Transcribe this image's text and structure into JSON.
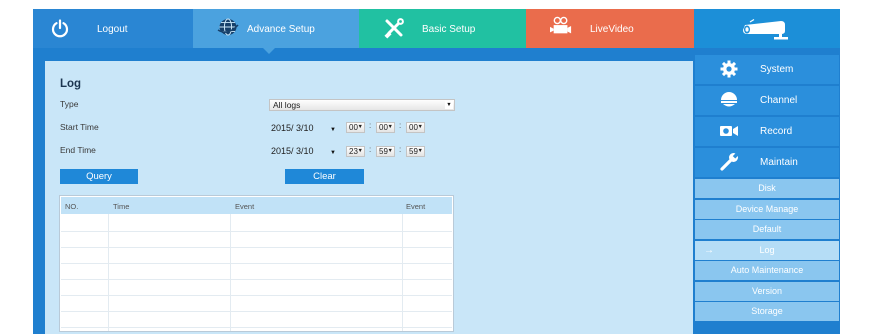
{
  "nav": {
    "tabs": [
      {
        "label": "Logout",
        "icon": "power-icon",
        "color": "#2a86d3"
      },
      {
        "label": "Advance Setup",
        "icon": "globe-icon",
        "color": "#4ba2df"
      },
      {
        "label": "Basic Setup",
        "icon": "tools-icon",
        "color": "#21c1a2"
      },
      {
        "label": "LiveVideo",
        "icon": "video-camera-icon",
        "color": "#ea6c4c"
      }
    ],
    "camera_icon": "bullet-camera-icon"
  },
  "log": {
    "title": "Log",
    "type_label": "Type",
    "type_value": "All logs",
    "start_label": "Start Time",
    "start_date": "2015/ 3/10",
    "start_hour": "00",
    "start_min": "00",
    "start_sec": "00",
    "end_label": "End Time",
    "end_date": "2015/ 3/10",
    "end_hour": "23",
    "end_min": "59",
    "end_sec": "59",
    "query_label": "Query",
    "clear_label": "Clear",
    "columns": [
      "NO.",
      "Time",
      "Event",
      "Event"
    ],
    "rows": []
  },
  "menu": {
    "main_items": [
      {
        "label": "System",
        "icon": "gear-icon"
      },
      {
        "label": "Channel",
        "icon": "dome-camera-icon"
      },
      {
        "label": "Record",
        "icon": "record-camera-icon"
      },
      {
        "label": "Maintain",
        "icon": "wrench-icon"
      }
    ],
    "sub_items": [
      {
        "label": "Disk"
      },
      {
        "label": "Device Manage"
      },
      {
        "label": "Default"
      },
      {
        "label": "Log",
        "active": true
      },
      {
        "label": "Auto Maintenance"
      },
      {
        "label": "Version"
      },
      {
        "label": "Storage"
      }
    ]
  },
  "colors": {
    "primary": "#1f7fcf",
    "panel": "#c9e6f8",
    "button": "#1f88d8",
    "submenu": "#8ac6ef",
    "submenu_active": "#b5ddf6"
  }
}
